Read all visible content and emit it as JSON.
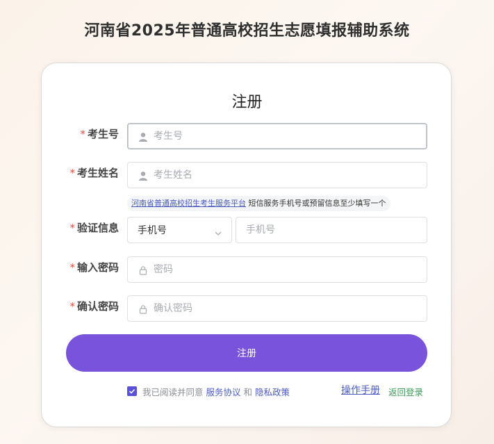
{
  "system_title": "河南省2025年普通高校招生志愿填报辅助系统",
  "form": {
    "title": "注册",
    "exam_id": {
      "label": "考生号",
      "placeholder": "考生号"
    },
    "name": {
      "label": "考生姓名",
      "placeholder": "考生姓名"
    },
    "hint": {
      "link_text": "河南省普通高校招生考生服务平台",
      "text": "短信服务手机号或预留信息至少填写一个"
    },
    "verify": {
      "label": "验证信息",
      "select_value": "手机号",
      "placeholder": "手机号"
    },
    "password": {
      "label": "输入密码",
      "placeholder": "密码"
    },
    "confirm": {
      "label": "确认密码",
      "placeholder": "确认密码"
    },
    "required_mark": "*",
    "submit_label": "注册",
    "agreement": {
      "checked": true,
      "prefix": "我已阅读并同意",
      "service_link": "服务协议",
      "and": "和",
      "privacy_link": "隐私政策"
    },
    "manual_link": "操作手册",
    "back_link": "返回登录"
  },
  "colors": {
    "accent": "#7953db",
    "link": "#4a5bbf",
    "required": "#e74c3c",
    "back_link": "#3e9b5a"
  },
  "icons": {
    "user": "user-icon",
    "lock": "lock-icon",
    "chevron": "chevron-down-icon",
    "check": "check-icon"
  }
}
